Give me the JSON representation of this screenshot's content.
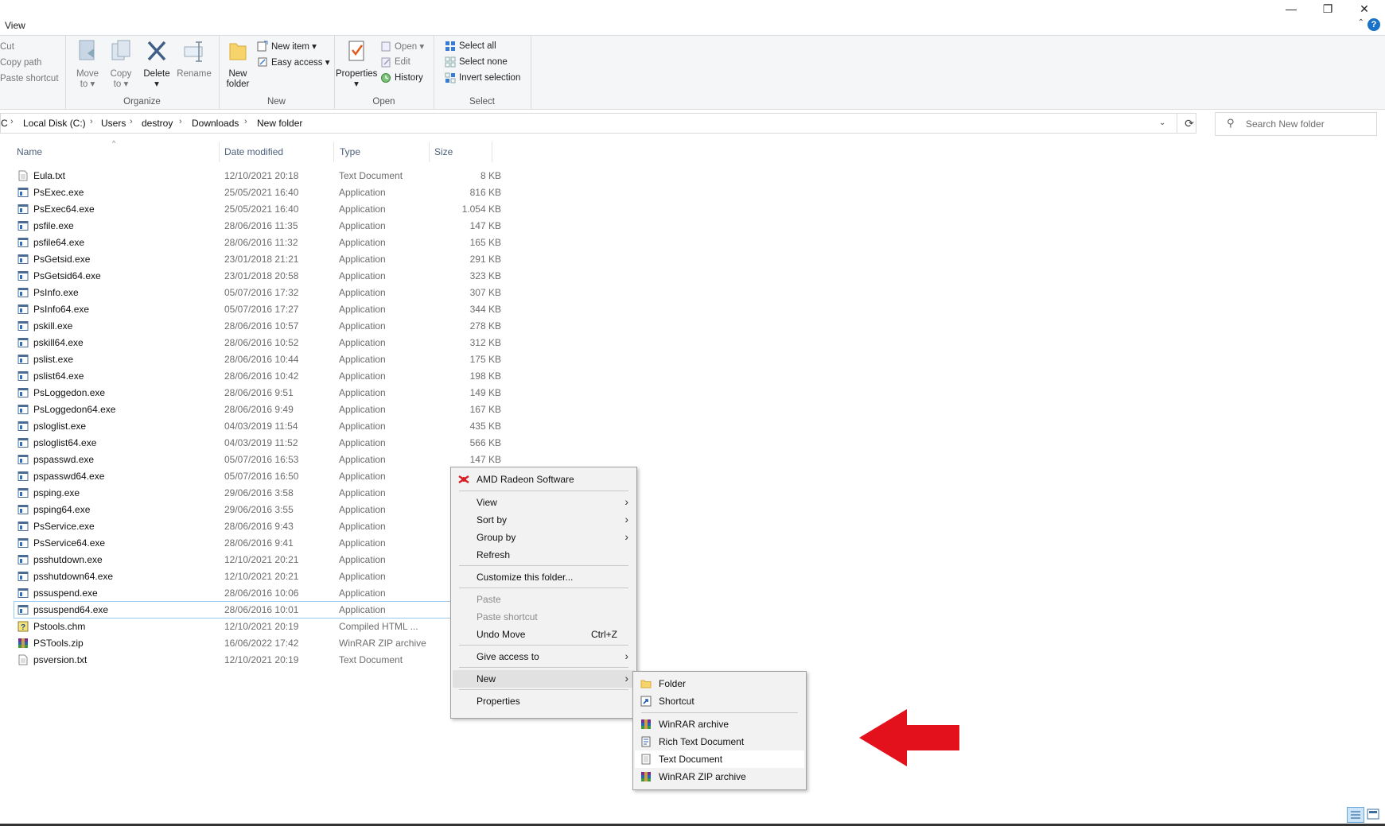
{
  "window": {
    "minimize": "—",
    "restore": "❐",
    "close": "✕"
  },
  "ribbon": {
    "tab": "View",
    "help": "?",
    "clipboard": {
      "cut": "Cut",
      "copy_path": "Copy path",
      "paste_shortcut": "Paste shortcut"
    },
    "organize": {
      "move_to_1": "Move",
      "move_to_2": "to ▾",
      "copy_to_1": "Copy",
      "copy_to_2": "to ▾",
      "delete_1": "Delete",
      "delete_2": "▾",
      "rename": "Rename",
      "label": "Organize"
    },
    "new": {
      "new_folder_1": "New",
      "new_folder_2": "folder",
      "new_item": "New item ▾",
      "easy_access": "Easy access ▾",
      "label": "New"
    },
    "open": {
      "properties_1": "Properties",
      "properties_2": "▾",
      "open": "Open ▾",
      "edit": "Edit",
      "history": "History",
      "label": "Open"
    },
    "select": {
      "select_all": "Select all",
      "select_none": "Select none",
      "invert_selection": "Invert selection",
      "label": "Select"
    }
  },
  "address": {
    "crumbs": [
      "C",
      "Local Disk (C:)",
      "Users",
      "destroy",
      "Downloads",
      "New folder"
    ],
    "search_placeholder": "Search New folder"
  },
  "columns": {
    "name": "Name",
    "date": "Date modified",
    "type": "Type",
    "size": "Size"
  },
  "files": [
    {
      "name": "Eula.txt",
      "date": "12/10/2021 20:18",
      "type": "Text Document",
      "size": "8 KB",
      "icon": "text-file-icon"
    },
    {
      "name": "PsExec.exe",
      "date": "25/05/2021 16:40",
      "type": "Application",
      "size": "816 KB",
      "icon": "application-icon"
    },
    {
      "name": "PsExec64.exe",
      "date": "25/05/2021 16:40",
      "type": "Application",
      "size": "1.054 KB",
      "icon": "application-icon"
    },
    {
      "name": "psfile.exe",
      "date": "28/06/2016 11:35",
      "type": "Application",
      "size": "147 KB",
      "icon": "application-icon"
    },
    {
      "name": "psfile64.exe",
      "date": "28/06/2016 11:32",
      "type": "Application",
      "size": "165 KB",
      "icon": "application-icon"
    },
    {
      "name": "PsGetsid.exe",
      "date": "23/01/2018 21:21",
      "type": "Application",
      "size": "291 KB",
      "icon": "application-icon"
    },
    {
      "name": "PsGetsid64.exe",
      "date": "23/01/2018 20:58",
      "type": "Application",
      "size": "323 KB",
      "icon": "application-icon"
    },
    {
      "name": "PsInfo.exe",
      "date": "05/07/2016 17:32",
      "type": "Application",
      "size": "307 KB",
      "icon": "application-icon"
    },
    {
      "name": "PsInfo64.exe",
      "date": "05/07/2016 17:27",
      "type": "Application",
      "size": "344 KB",
      "icon": "application-icon"
    },
    {
      "name": "pskill.exe",
      "date": "28/06/2016 10:57",
      "type": "Application",
      "size": "278 KB",
      "icon": "application-icon"
    },
    {
      "name": "pskill64.exe",
      "date": "28/06/2016 10:52",
      "type": "Application",
      "size": "312 KB",
      "icon": "application-icon"
    },
    {
      "name": "pslist.exe",
      "date": "28/06/2016 10:44",
      "type": "Application",
      "size": "175 KB",
      "icon": "application-icon"
    },
    {
      "name": "pslist64.exe",
      "date": "28/06/2016 10:42",
      "type": "Application",
      "size": "198 KB",
      "icon": "application-icon"
    },
    {
      "name": "PsLoggedon.exe",
      "date": "28/06/2016 9:51",
      "type": "Application",
      "size": "149 KB",
      "icon": "application-icon"
    },
    {
      "name": "PsLoggedon64.exe",
      "date": "28/06/2016 9:49",
      "type": "Application",
      "size": "167 KB",
      "icon": "application-icon"
    },
    {
      "name": "psloglist.exe",
      "date": "04/03/2019 11:54",
      "type": "Application",
      "size": "435 KB",
      "icon": "application-icon"
    },
    {
      "name": "psloglist64.exe",
      "date": "04/03/2019 11:52",
      "type": "Application",
      "size": "566 KB",
      "icon": "application-icon"
    },
    {
      "name": "pspasswd.exe",
      "date": "05/07/2016 16:53",
      "type": "Application",
      "size": "147 KB",
      "icon": "application-icon"
    },
    {
      "name": "pspasswd64.exe",
      "date": "05/07/2016 16:50",
      "type": "Application",
      "size": "",
      "icon": "application-icon"
    },
    {
      "name": "psping.exe",
      "date": "29/06/2016 3:58",
      "type": "Application",
      "size": "",
      "icon": "application-icon"
    },
    {
      "name": "psping64.exe",
      "date": "29/06/2016 3:55",
      "type": "Application",
      "size": "",
      "icon": "application-icon"
    },
    {
      "name": "PsService.exe",
      "date": "28/06/2016 9:43",
      "type": "Application",
      "size": "",
      "icon": "application-icon"
    },
    {
      "name": "PsService64.exe",
      "date": "28/06/2016 9:41",
      "type": "Application",
      "size": "",
      "icon": "application-icon"
    },
    {
      "name": "psshutdown.exe",
      "date": "12/10/2021 20:21",
      "type": "Application",
      "size": "",
      "icon": "application-icon"
    },
    {
      "name": "psshutdown64.exe",
      "date": "12/10/2021 20:21",
      "type": "Application",
      "size": "",
      "icon": "application-icon"
    },
    {
      "name": "pssuspend.exe",
      "date": "28/06/2016 10:06",
      "type": "Application",
      "size": "",
      "icon": "application-icon"
    },
    {
      "name": "pssuspend64.exe",
      "date": "28/06/2016 10:01",
      "type": "Application",
      "size": "",
      "icon": "application-icon"
    },
    {
      "name": "Pstools.chm",
      "date": "12/10/2021 20:19",
      "type": "Compiled HTML ...",
      "size": "",
      "icon": "help-file-icon"
    },
    {
      "name": "PSTools.zip",
      "date": "16/06/2022 17:42",
      "type": "WinRAR ZIP archive",
      "size": "",
      "icon": "winrar-icon"
    },
    {
      "name": "psversion.txt",
      "date": "12/10/2021 20:19",
      "type": "Text Document",
      "size": "",
      "icon": "text-file-icon"
    }
  ],
  "context_menu": {
    "amd": "AMD Radeon Software",
    "view": "View",
    "sort_by": "Sort by",
    "group_by": "Group by",
    "refresh": "Refresh",
    "customize": "Customize this folder...",
    "paste": "Paste",
    "paste_shortcut": "Paste shortcut",
    "undo_move": "Undo Move",
    "undo_shortcut": "Ctrl+Z",
    "give_access": "Give access to",
    "new": "New",
    "properties": "Properties"
  },
  "new_submenu": {
    "folder": "Folder",
    "shortcut": "Shortcut",
    "winrar_archive": "WinRAR archive",
    "rich_text": "Rich Text Document",
    "text_document": "Text Document",
    "winrar_zip": "WinRAR ZIP archive"
  },
  "colors": {
    "accent": "#1a73c7",
    "arrow": "#e3111b",
    "selection_outline": "#99c9ef"
  }
}
